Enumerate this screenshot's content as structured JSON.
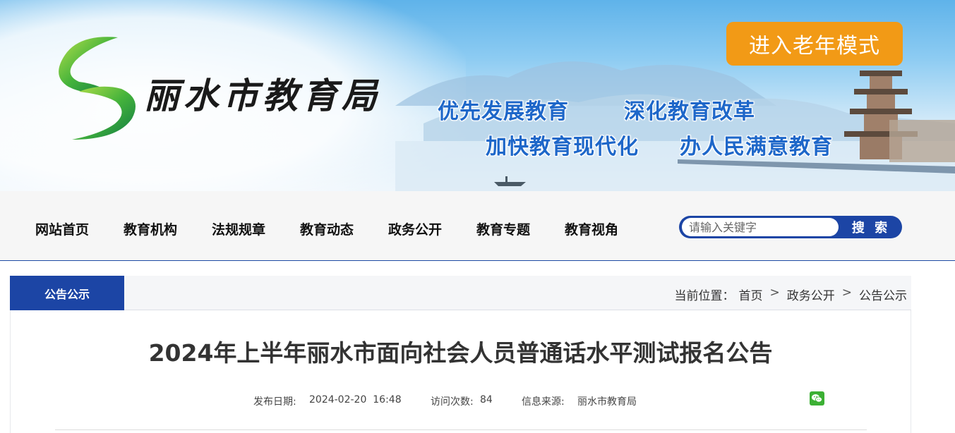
{
  "banner": {
    "site_name": "丽水市教育局",
    "slogans": [
      "优先发展教育",
      "深化教育改革",
      "加快教育现代化",
      "办人民满意教育"
    ],
    "elder_mode_label": "进入老年模式"
  },
  "nav": {
    "items": [
      "网站首页",
      "教育机构",
      "法规规章",
      "教育动态",
      "政务公开",
      "教育专题",
      "教育视角"
    ]
  },
  "search": {
    "placeholder": "请输入关键字",
    "button_label": "搜 索"
  },
  "section": {
    "tab_label": "公告公示",
    "breadcrumb_prefix": "当前位置：",
    "breadcrumb": [
      "首页",
      "政务公开",
      "公告公示"
    ],
    "separator": ">"
  },
  "article": {
    "title": "2024年上半年丽水市面向社会人员普通话水平测试报名公告",
    "publish_label": "发布日期:",
    "publish_date": "2024-02-20  16:48",
    "visits_label": "访问次数:",
    "visits": "84",
    "source_label": "信息来源:",
    "source": "丽水市教育局"
  },
  "colors": {
    "brand_blue": "#1c45a5",
    "elder_orange": "#f29a16",
    "slogan_blue": "#1e67c9",
    "wechat_green": "#3cb034"
  },
  "icons": [
    "logo-swirl-icon",
    "wechat-icon"
  ]
}
